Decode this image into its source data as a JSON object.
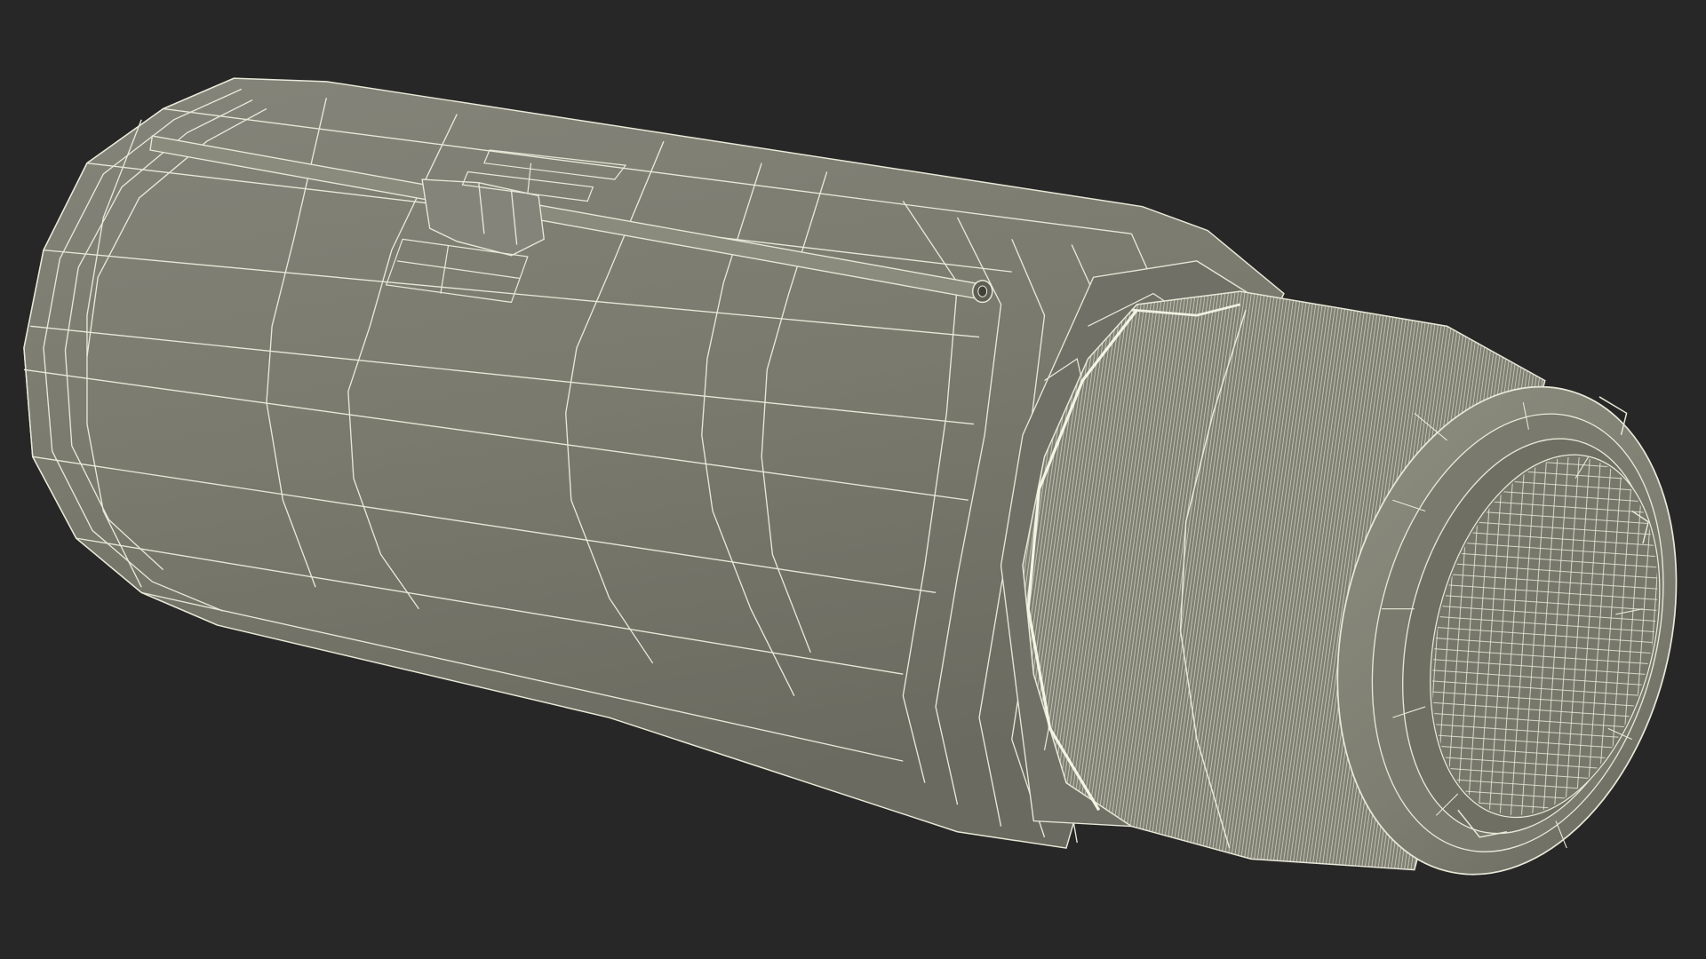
{
  "scene": {
    "background_color": "#272727",
    "subject": "cylindrical-canister-wireframe",
    "render_mode": "wireframe-over-shaded",
    "colors": {
      "body_fill": "#7a7a6e",
      "body_shadow": "#67675c",
      "body_highlight": "#8a8a7d",
      "cap_fill": "#858577",
      "cap_dark": "#5f5f55",
      "wire": "#e8e8d8",
      "wire_dense": "#cfcfbf"
    }
  }
}
